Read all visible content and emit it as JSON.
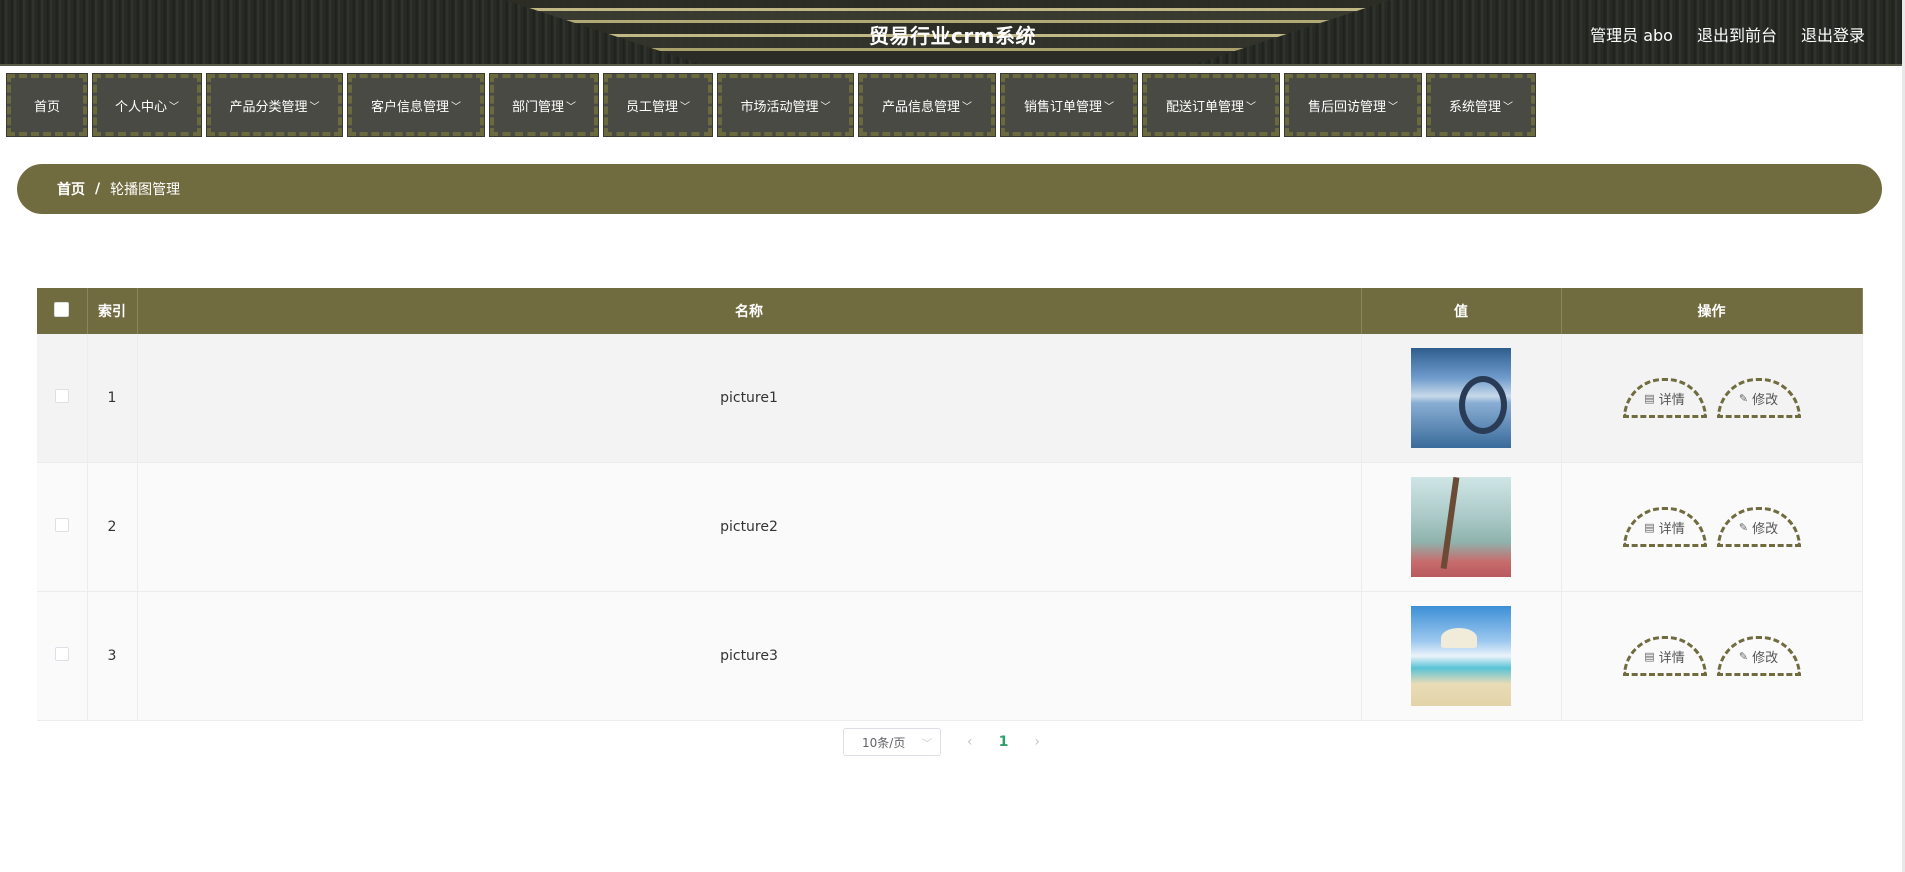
{
  "header": {
    "title": "贸易行业crm系统",
    "user_label": "管理员 abo",
    "to_front_label": "退出到前台",
    "logout_label": "退出登录"
  },
  "nav": {
    "items": [
      {
        "label": "首页",
        "dropdown": false
      },
      {
        "label": "个人中心",
        "dropdown": true
      },
      {
        "label": "产品分类管理",
        "dropdown": true
      },
      {
        "label": "客户信息管理",
        "dropdown": true
      },
      {
        "label": "部门管理",
        "dropdown": true
      },
      {
        "label": "员工管理",
        "dropdown": true
      },
      {
        "label": "市场活动管理",
        "dropdown": true
      },
      {
        "label": "产品信息管理",
        "dropdown": true
      },
      {
        "label": "销售订单管理",
        "dropdown": true
      },
      {
        "label": "配送订单管理",
        "dropdown": true
      },
      {
        "label": "售后回访管理",
        "dropdown": true
      },
      {
        "label": "系统管理",
        "dropdown": true
      }
    ]
  },
  "breadcrumb": {
    "home": "首页",
    "separator": "/",
    "current": "轮播图管理"
  },
  "table": {
    "headers": {
      "index": "索引",
      "name": "名称",
      "value": "值",
      "actions": "操作"
    },
    "rows": [
      {
        "index": "1",
        "name": "picture1",
        "image": "picture1-thumbnail"
      },
      {
        "index": "2",
        "name": "picture2",
        "image": "picture2-thumbnail"
      },
      {
        "index": "3",
        "name": "picture3",
        "image": "picture3-thumbnail"
      }
    ],
    "detail_label": "详情",
    "edit_label": "修改"
  },
  "pagination": {
    "page_size": "10条/页",
    "current_page": "1"
  },
  "colors": {
    "accent": "#716c40",
    "header_bg": "#2b2d28",
    "nav_bg": "#4a4a44",
    "active_page": "#2e9e6b"
  },
  "icons": {
    "detail": "document-icon",
    "edit": "pencil-icon",
    "chevron": "chevron-down-icon"
  }
}
